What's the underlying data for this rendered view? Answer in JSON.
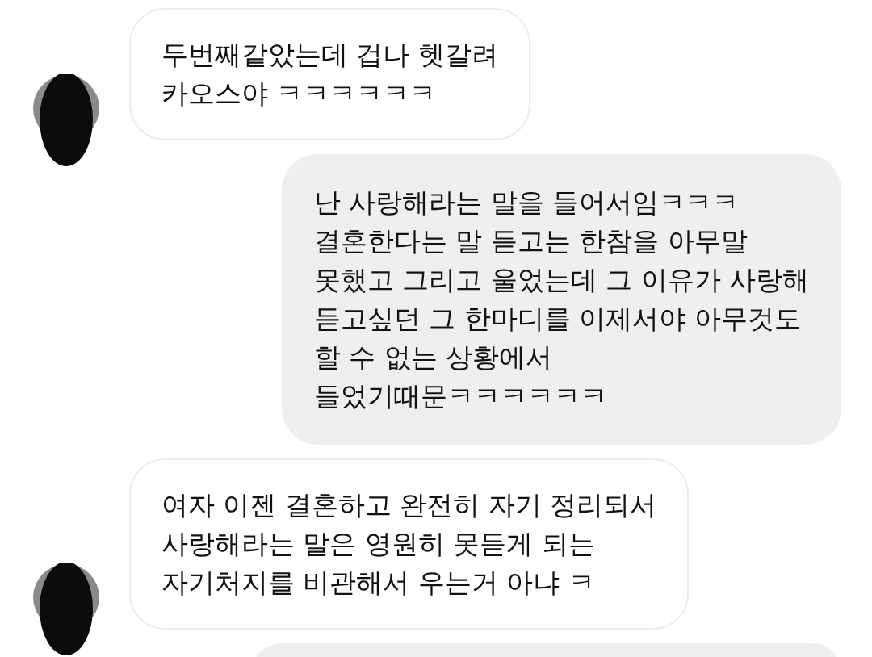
{
  "messages": [
    {
      "kind": "received",
      "lines": [
        "두번째같았는데 겁나 헷갈려",
        "카오스야 ㅋㅋㅋㅋㅋㅋ"
      ]
    },
    {
      "kind": "sent",
      "lines": [
        "난 사랑해라는 말을 들어서임ㅋㅋㅋ",
        "결혼한다는 말 듣고는 한참을 아무말",
        "못했고 그리고 울었는데 그 이유가 사랑해",
        "듣고싶던 그 한마디를 이제서야 아무것도",
        "할 수 없는 상황에서",
        "들었기때문ㅋㅋㅋㅋㅋㅋ"
      ]
    },
    {
      "kind": "received",
      "lines": [
        "여자 이젠 결혼하고 완전히 자기 정리되서",
        "사랑해라는 말은 영원히 못듣게 되는",
        "자기처지를 비관해서 우는거 아냐 ㅋ"
      ]
    },
    {
      "kind": "sent"
    }
  ]
}
